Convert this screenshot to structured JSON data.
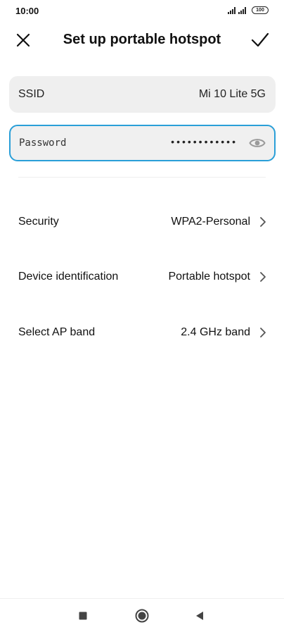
{
  "status_bar": {
    "time": "10:00",
    "battery": "100",
    "icons": [
      "signal-icon",
      "signal-icon",
      "battery-icon"
    ]
  },
  "header": {
    "title": "Set up portable hotspot",
    "close_icon": "close-icon",
    "confirm_icon": "check-icon"
  },
  "ssid": {
    "label": "SSID",
    "value": "Mi 10 Lite 5G"
  },
  "password": {
    "label": "Password",
    "masked_value": "••••••••••••",
    "visibility_icon": "eye-icon"
  },
  "settings": {
    "items": [
      {
        "label": "Security",
        "value": "WPA2-Personal"
      },
      {
        "label": "Device identification",
        "value": "Portable hotspot"
      },
      {
        "label": "Select AP band",
        "value": "2.4 GHz band"
      }
    ]
  },
  "nav_bar": {
    "icons": [
      "recents-icon",
      "home-icon",
      "back-icon"
    ]
  },
  "colors": {
    "accent": "#2a9fd8",
    "field_bg": "#efefef",
    "text": "#111111"
  }
}
